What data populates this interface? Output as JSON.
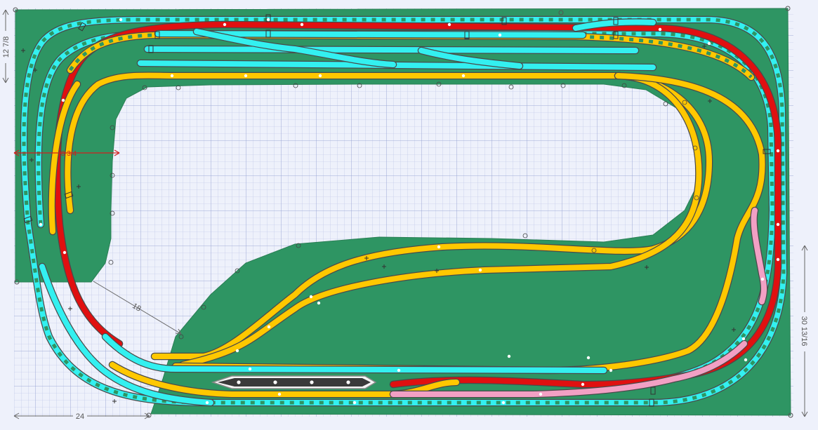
{
  "colors": {
    "background": "#eef1fb",
    "grid": "#9aa7d6",
    "board": "#2e9563",
    "track_outline": "#4a4a4a",
    "yellow_track": "#ffc800",
    "cyan_track": "#33f0f0",
    "red_track": "#e01010",
    "pink_track": "#f2a0c4",
    "platform": "#3a3a3a",
    "dimension_red": "#d0201e",
    "dimension_gray": "#666666"
  },
  "dimensions": {
    "top_left_height": "12 7/8",
    "red_width": "8 3/4",
    "diagonal": "18",
    "right_height": "30 13/16",
    "bottom_width": "24"
  }
}
